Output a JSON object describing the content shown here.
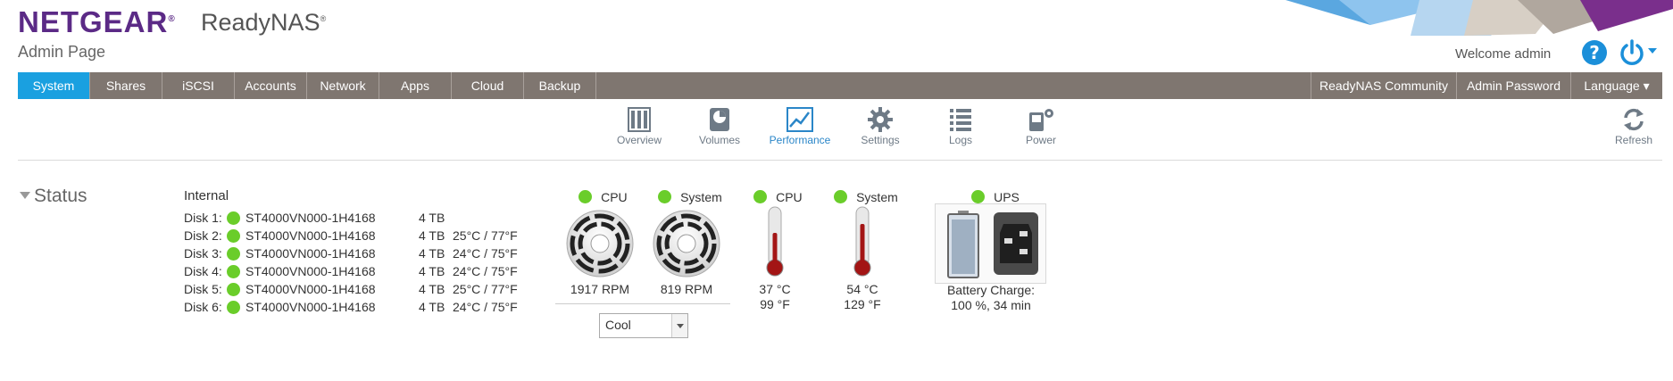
{
  "header": {
    "brand": "NETGEAR",
    "product": "ReadyNAS",
    "subtitle": "Admin Page",
    "welcome": "Welcome admin",
    "help_glyph": "?"
  },
  "nav": {
    "tabs": [
      {
        "label": "System",
        "active": true
      },
      {
        "label": "Shares"
      },
      {
        "label": "iSCSI"
      },
      {
        "label": "Accounts"
      },
      {
        "label": "Network"
      },
      {
        "label": "Apps"
      },
      {
        "label": "Cloud"
      },
      {
        "label": "Backup"
      }
    ],
    "right_tabs": [
      {
        "label": "ReadyNAS Community"
      },
      {
        "label": "Admin Password"
      },
      {
        "label": "Language ▾"
      }
    ]
  },
  "subnav": {
    "items": [
      {
        "label": "Overview",
        "icon": "overview-icon"
      },
      {
        "label": "Volumes",
        "icon": "volumes-icon"
      },
      {
        "label": "Performance",
        "icon": "performance-icon",
        "active": true
      },
      {
        "label": "Settings",
        "icon": "gear-icon"
      },
      {
        "label": "Logs",
        "icon": "logs-icon"
      },
      {
        "label": "Power",
        "icon": "power-settings-icon"
      }
    ],
    "refresh": "Refresh"
  },
  "status": {
    "title": "Status",
    "internal_label": "Internal",
    "disks": [
      {
        "name": "Disk 1:",
        "model": "ST4000VN000-1H4168",
        "size": "4 TB",
        "temp": ""
      },
      {
        "name": "Disk 2:",
        "model": "ST4000VN000-1H4168",
        "size": "4 TB",
        "temp": "25°C / 77°F"
      },
      {
        "name": "Disk 3:",
        "model": "ST4000VN000-1H4168",
        "size": "4 TB",
        "temp": "24°C / 75°F"
      },
      {
        "name": "Disk 4:",
        "model": "ST4000VN000-1H4168",
        "size": "4 TB",
        "temp": "24°C / 75°F"
      },
      {
        "name": "Disk 5:",
        "model": "ST4000VN000-1H4168",
        "size": "4 TB",
        "temp": "25°C / 77°F"
      },
      {
        "name": "Disk 6:",
        "model": "ST4000VN000-1H4168",
        "size": "4 TB",
        "temp": "24°C / 75°F"
      }
    ],
    "fans": [
      {
        "label": "CPU",
        "rpm": "1917 RPM"
      },
      {
        "label": "System",
        "rpm": "819 RPM"
      }
    ],
    "fan_mode": "Cool",
    "temps": [
      {
        "label": "CPU",
        "c": "37 °C",
        "f": "99 °F"
      },
      {
        "label": "System",
        "c": "54 °C",
        "f": "129 °F"
      }
    ],
    "ups": {
      "label": "UPS",
      "battery_label": "Battery Charge:",
      "battery_value": "100 %, 34 min"
    }
  },
  "colors": {
    "brand_purple": "#5b2a86",
    "nav_bg": "#7f7670",
    "nav_active": "#1aa0e0",
    "status_ok": "#6acd2a",
    "accent_blue": "#1b8fd9"
  }
}
